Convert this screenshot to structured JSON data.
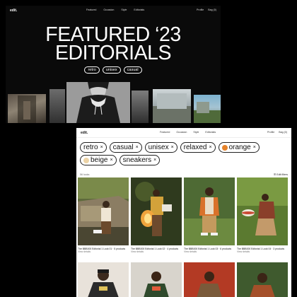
{
  "back_window": {
    "logo": "edit.",
    "nav_links": [
      "Featured",
      "Occasion",
      "Style",
      "Editorials"
    ],
    "nav_right": [
      "Profile",
      "Bag (0)"
    ],
    "hero_title_line1": "FEATURED ‘23",
    "hero_title_line2": "EDITORIALS",
    "tags": [
      "retro",
      "unisex",
      "casual"
    ]
  },
  "front_window": {
    "logo": "edit.",
    "nav_links": [
      "Featured",
      "Occasion",
      "Style",
      "Editorials"
    ],
    "nav_right": [
      "Profile",
      "Bag (0)"
    ],
    "filters": [
      {
        "label": "retro",
        "dot": null
      },
      {
        "label": "casual",
        "dot": null
      },
      {
        "label": "unisex",
        "dot": null
      },
      {
        "label": "relaxed",
        "dot": null
      },
      {
        "label": "orange",
        "dot": "#e5832b"
      },
      {
        "label": "beige",
        "dot": "#ecd3a6"
      },
      {
        "label": "sneakers",
        "dot": null
      }
    ],
    "remove_glyph": "×",
    "results_count": "56 looks",
    "edit_filters": "Edit filters",
    "cards": [
      {
        "caption": "The BBB000 Editorial 1 Look 01 · 5 products",
        "sub": "View details"
      },
      {
        "caption": "The BBB000 Editorial 1 Look 02 · 4 products",
        "sub": "View details"
      },
      {
        "caption": "The BBB000 Editorial 1 Look 03 · 6 products",
        "sub": "View details"
      },
      {
        "caption": "The BBB000 Editorial 1 Look 04 · 3 products",
        "sub": "View details"
      }
    ]
  }
}
